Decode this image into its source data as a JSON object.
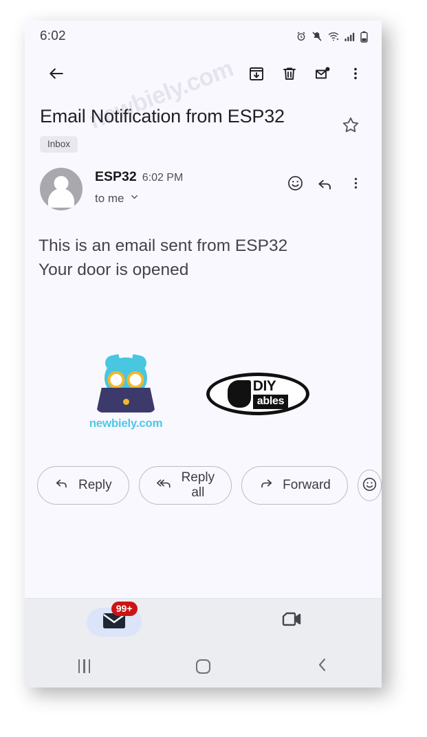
{
  "status_bar": {
    "time": "6:02",
    "icons": [
      "alarm-icon",
      "mute-icon",
      "wifi-icon",
      "signal-icon",
      "battery-icon"
    ]
  },
  "toolbar": {
    "back_icon": "back-arrow-icon",
    "archive_icon": "archive-icon",
    "delete_icon": "trash-icon",
    "unread_icon": "mark-unread-icon",
    "overflow_icon": "more-vertical-icon"
  },
  "email": {
    "subject": "Email Notification from ESP32",
    "label": "Inbox",
    "star_icon": "star-outline-icon",
    "sender": {
      "name": "ESP32",
      "time": "6:02 PM",
      "recipient": "to me",
      "expand_icon": "chevron-down-icon",
      "avatar_icon": "person-avatar-icon",
      "react_icon": "emoji-smile-icon",
      "reply_icon": "reply-arrow-icon",
      "overflow_icon": "more-vertical-icon"
    },
    "body_lines": [
      "This is an email sent from ESP32",
      "Your door is opened"
    ]
  },
  "signature_logos": {
    "newbiely": {
      "name": "newbiely-logo",
      "text": "newbiely.com",
      "owl_color": "#49c6e0",
      "glasses_color": "#f0b92b",
      "laptop_color": "#3c3a6b",
      "text_color": "#4cc9e8"
    },
    "diyables": {
      "name": "diyables-logo",
      "text_top": "DIY",
      "text_bottom": "ables",
      "color": "#111111"
    }
  },
  "actions": {
    "reply": {
      "label": "Reply",
      "icon": "reply-arrow-icon"
    },
    "reply_all": {
      "label": "Reply all",
      "icon": "reply-all-arrow-icon"
    },
    "forward": {
      "label": "Forward",
      "icon": "forward-arrow-icon"
    },
    "react": {
      "icon": "emoji-smile-icon"
    }
  },
  "bottom_nav": {
    "mail": {
      "icon": "mail-icon",
      "badge": "99+",
      "selected": true,
      "pill_color": "#dbe4f8",
      "badge_color": "#cc1414"
    },
    "meet": {
      "icon": "video-camera-icon",
      "selected": false
    }
  },
  "android_nav": {
    "recents_icon": "recents-icon",
    "home_icon": "home-icon",
    "back_icon": "back-chevron-icon"
  },
  "watermark": {
    "text": "newbiely.com"
  },
  "colors": {
    "screen_bg": "#faf8ff",
    "nav_bg": "#ebedf1",
    "text_primary": "#1f1f24",
    "text_secondary": "#4e4e57",
    "chip_bg": "#e9e8ed"
  }
}
